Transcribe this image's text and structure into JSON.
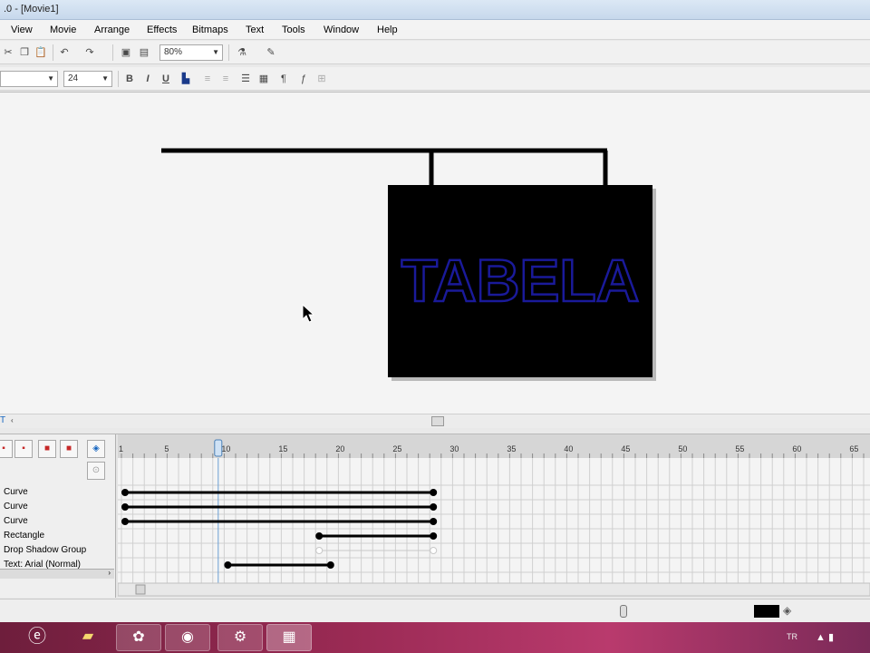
{
  "window": {
    "title": ".0 - [Movie1]"
  },
  "menu": [
    "View",
    "Movie",
    "Arrange",
    "Effects",
    "Bitmaps",
    "Text",
    "Tools",
    "Window",
    "Help"
  ],
  "toolbar": {
    "zoom": "80%",
    "font_size": "24",
    "bold": "B",
    "italic": "I",
    "underline": "U"
  },
  "stage": {
    "sign_text": "TABELA",
    "sign_text_color": "#1a1a9a",
    "board_color": "#000000"
  },
  "timeline": {
    "ruler": [
      "1",
      "5",
      "10",
      "15",
      "20",
      "25",
      "30",
      "35",
      "40",
      "45",
      "50",
      "55",
      "60",
      "65"
    ],
    "current_frame": 9,
    "layers": [
      {
        "name": "Curve",
        "start": 1,
        "end": 28
      },
      {
        "name": "Curve",
        "start": 1,
        "end": 28
      },
      {
        "name": "Curve",
        "start": 1,
        "end": 28
      },
      {
        "name": "Rectangle",
        "start": 18,
        "end": 28
      },
      {
        "name": "Drop Shadow Group",
        "start": 18,
        "end": 28,
        "faded": true
      },
      {
        "name": "Text: Arial (Normal)",
        "start": 10,
        "end": 19
      }
    ]
  },
  "taskbar": {
    "lang": "TR"
  }
}
